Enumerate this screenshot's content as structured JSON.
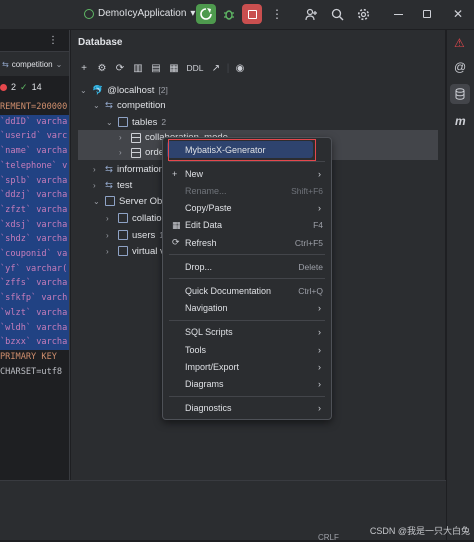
{
  "topbar": {
    "app_name": "DemoIcyApplication",
    "chevron": "▾"
  },
  "editor": {
    "tab_label": "competition",
    "status": {
      "errors": "2",
      "ok": "14"
    },
    "lines": [
      "REMENT=200000",
      "",
      "",
      "`ddID` varcha",
      "`userid` varc",
      "`name` varcha",
      "`telephone` v",
      "`splb` varcha",
      "`ddzj` varcha",
      "`zfzt` varcha",
      "`xdsj` varcha",
      "`shdz` varcha",
      "`couponid` va",
      "`yf` varchar(",
      "`zffs` varcha",
      "`sfkfp` varch",
      "`wlzt` varcha",
      "`wldh` varcha",
      "`bzxx` varcha",
      "PRIMARY KEY",
      "CHARSET=utf8"
    ]
  },
  "db": {
    "title": "Database",
    "toolbar_ddl": "DDL",
    "tree": [
      {
        "label": "@localhost",
        "badge": "[2]",
        "indent": 0,
        "chev": "⌄",
        "icon": "db"
      },
      {
        "label": "competition",
        "indent": 1,
        "chev": "⌄",
        "icon": "schema"
      },
      {
        "label": "tables",
        "badge": "2",
        "indent": 2,
        "chev": "⌄",
        "icon": "folder"
      },
      {
        "label": "collaboration_mode",
        "indent": 3,
        "chev": "›",
        "icon": "table"
      },
      {
        "label": "orde",
        "indent": 3,
        "chev": "›",
        "icon": "table"
      },
      {
        "label": "information",
        "indent": 1,
        "chev": "›",
        "icon": "schema"
      },
      {
        "label": "test",
        "indent": 1,
        "chev": "›",
        "icon": "schema"
      },
      {
        "label": "Server Obje",
        "indent": 1,
        "chev": "⌄",
        "icon": "folder"
      },
      {
        "label": "collatio",
        "indent": 2,
        "chev": "›",
        "icon": "folder"
      },
      {
        "label": "users",
        "badge": "1",
        "indent": 2,
        "chev": "›",
        "icon": "folder"
      },
      {
        "label": "virtual v",
        "indent": 2,
        "chev": "›",
        "icon": "folder"
      }
    ]
  },
  "menu": {
    "items": [
      {
        "label": "MybatisX-Generator",
        "shortcut": "",
        "arrow": false,
        "icon": "",
        "disabled": false,
        "highlight": true
      },
      {
        "sep": true
      },
      {
        "label": "New",
        "shortcut": "",
        "arrow": true,
        "icon": "+",
        "disabled": false
      },
      {
        "label": "Rename...",
        "shortcut": "Shift+F6",
        "arrow": false,
        "icon": "",
        "disabled": true
      },
      {
        "label": "Copy/Paste",
        "shortcut": "",
        "arrow": true,
        "icon": "",
        "disabled": false
      },
      {
        "label": "Edit Data",
        "shortcut": "F4",
        "arrow": false,
        "icon": "▦",
        "disabled": false
      },
      {
        "label": "Refresh",
        "shortcut": "Ctrl+F5",
        "arrow": false,
        "icon": "⟳",
        "disabled": false
      },
      {
        "sep": true
      },
      {
        "label": "Drop...",
        "shortcut": "Delete",
        "arrow": false,
        "icon": "",
        "disabled": false
      },
      {
        "sep": true
      },
      {
        "label": "Quick Documentation",
        "shortcut": "Ctrl+Q",
        "arrow": false,
        "icon": "",
        "disabled": false
      },
      {
        "label": "Navigation",
        "shortcut": "",
        "arrow": true,
        "icon": "",
        "disabled": false
      },
      {
        "sep": true
      },
      {
        "label": "SQL Scripts",
        "shortcut": "",
        "arrow": true,
        "icon": "",
        "disabled": false
      },
      {
        "label": "Tools",
        "shortcut": "",
        "arrow": true,
        "icon": "",
        "disabled": false
      },
      {
        "label": "Import/Export",
        "shortcut": "",
        "arrow": true,
        "icon": "",
        "disabled": false
      },
      {
        "label": "Diagrams",
        "shortcut": "",
        "arrow": true,
        "icon": "",
        "disabled": false
      },
      {
        "sep": true
      },
      {
        "label": "Diagnostics",
        "shortcut": "",
        "arrow": true,
        "icon": "",
        "disabled": false
      }
    ]
  },
  "bottom": {
    "status_text": "CRLF"
  },
  "watermark": "CSDN @我是一只大白兔",
  "colors": {
    "accent": "#3574f0",
    "selection": "#214283",
    "menu_highlight": "#2e436e",
    "red_box": "#e5484d",
    "run_green": "#4e9a4e",
    "stop_red": "#c94f4f"
  }
}
